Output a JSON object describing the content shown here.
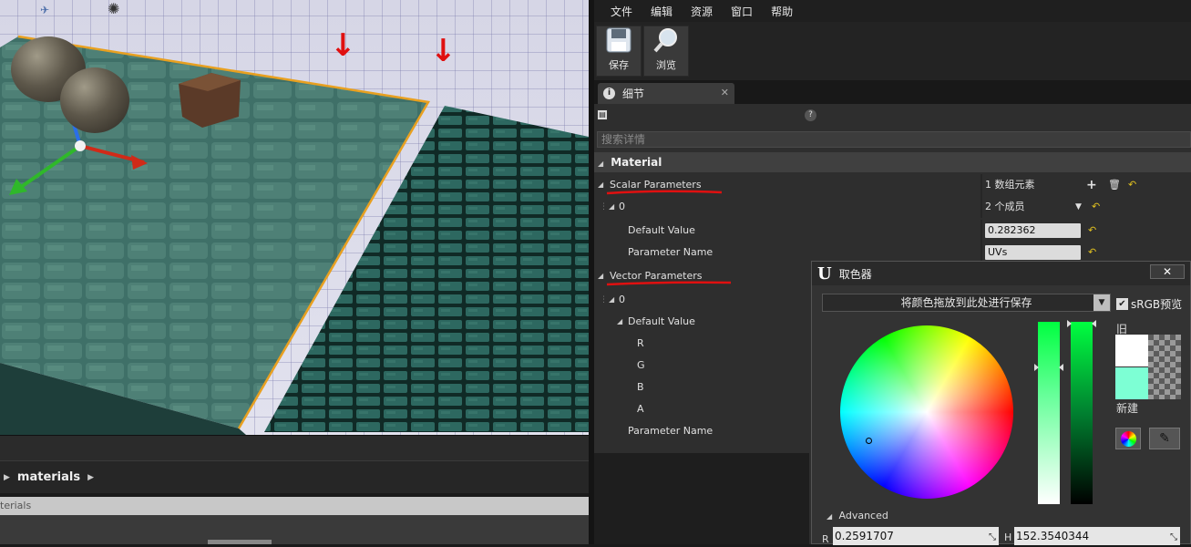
{
  "cb": {
    "crumb": "materials",
    "search_text": "terials"
  },
  "menu": [
    "文件",
    "编辑",
    "资源",
    "窗口",
    "帮助"
  ],
  "toolbar": {
    "save": "保存",
    "browse": "浏览"
  },
  "tab": {
    "title": "细节",
    "close": "✕"
  },
  "details": {
    "search_placeholder": "搜索详情",
    "help": "?",
    "category": "Material",
    "scalar_params": "Scalar Parameters",
    "array_count": "1 数组元素",
    "idx0": "0",
    "members": "2 个成员",
    "default_value": "Default Value",
    "default_value_num": "0.282362",
    "param_name": "Parameter Name",
    "param_name_val": "UVs",
    "vector_params": "Vector Parameters",
    "vidx0": "0",
    "v_default": "Default Value",
    "r": "R",
    "g": "G",
    "b": "B",
    "a": "A",
    "v_param_name": "Parameter Name"
  },
  "picker": {
    "title": "取色器",
    "close": "✕",
    "drop_label": "将颜色拖放到此处进行保存",
    "srgb": "sRGB预览",
    "old": "旧",
    "new": "新建",
    "advanced": "Advanced",
    "r_label": "R",
    "r_value": "0.2591707",
    "h_label": "H",
    "h_value": "152.3540344",
    "old_color": "#ffffff",
    "new_color": "#7dffd4"
  }
}
